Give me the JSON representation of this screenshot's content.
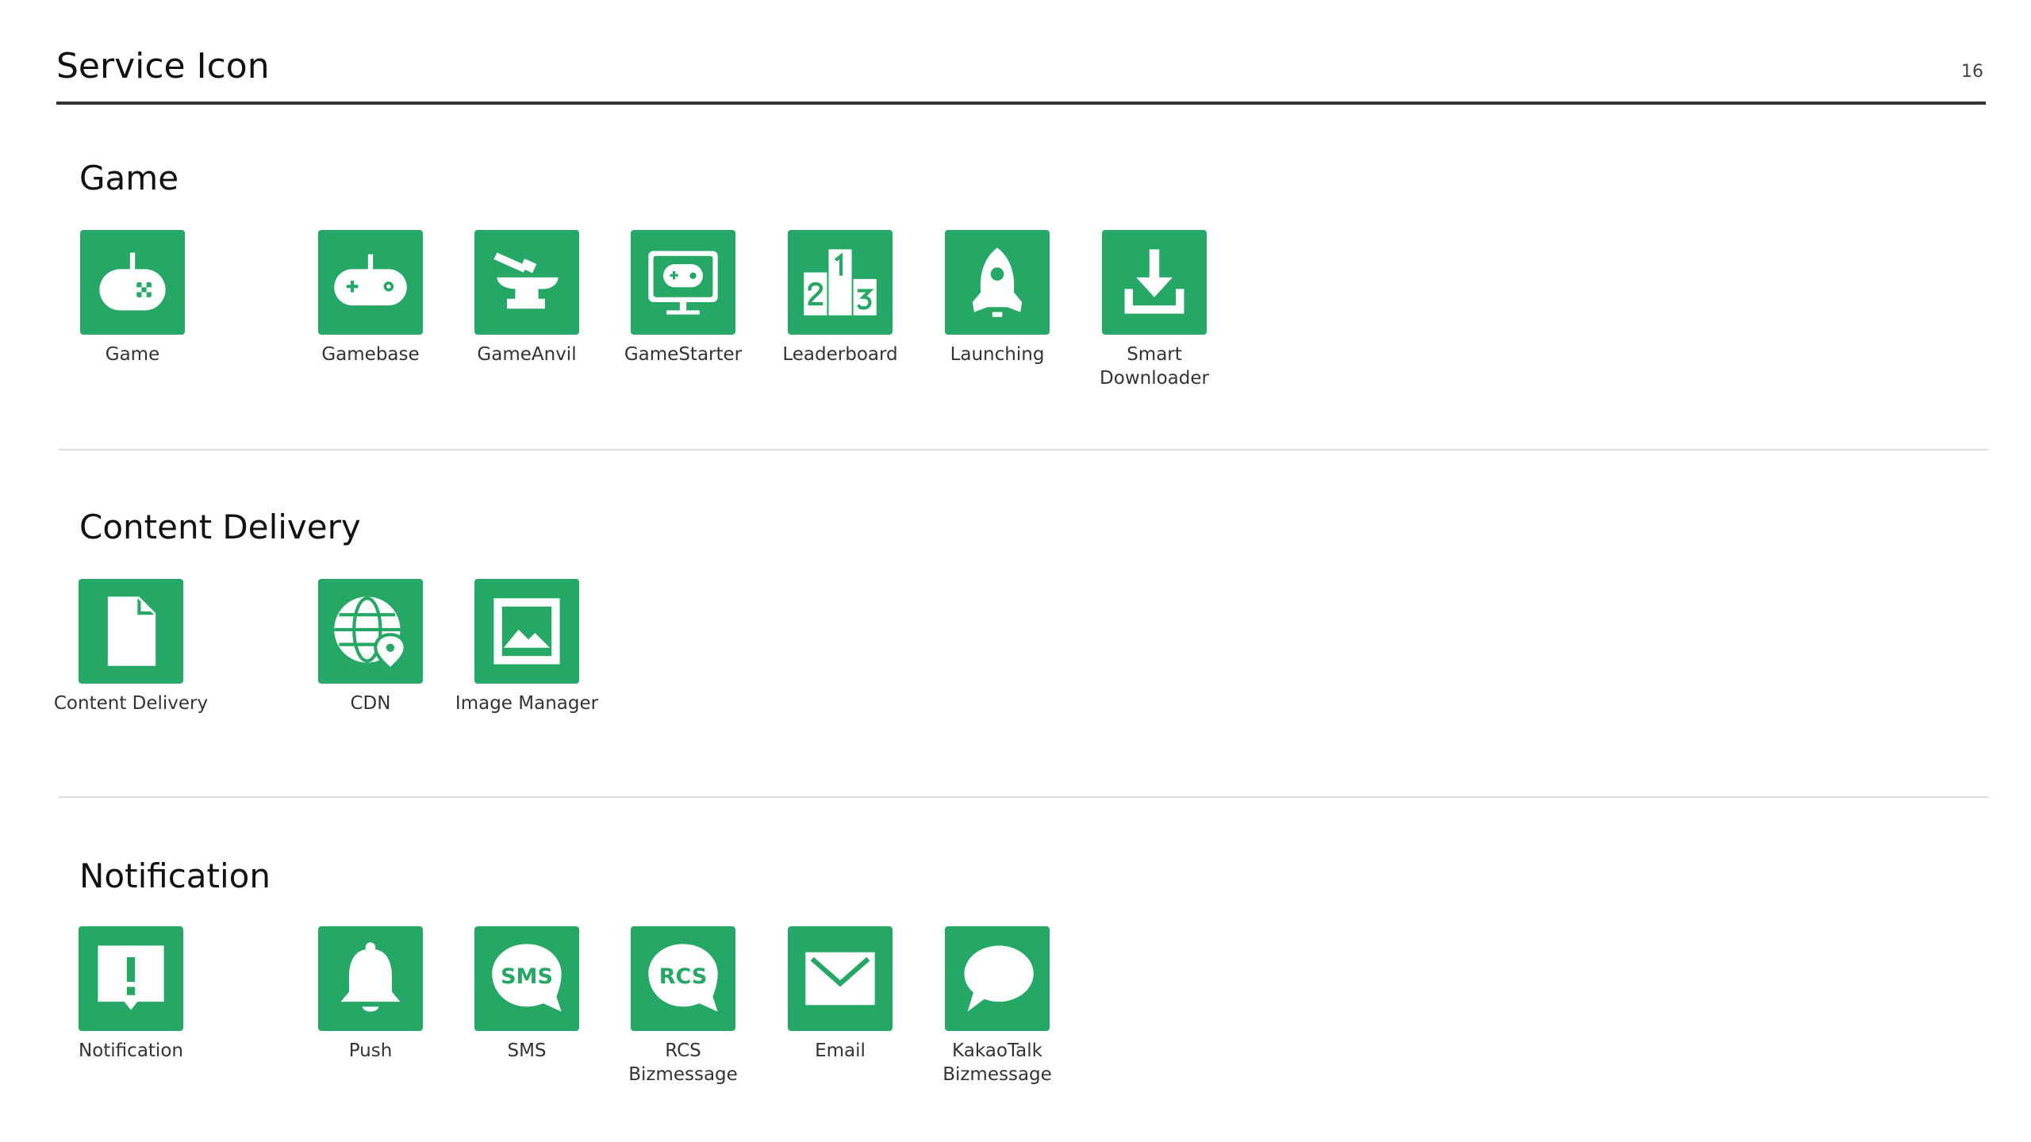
{
  "header": {
    "title": "Service Icon",
    "page_number": "16"
  },
  "sections": {
    "game": {
      "title": "Game",
      "items": [
        {
          "label": "Game",
          "icon": "gamepad-icon"
        },
        {
          "label": "Gamebase",
          "icon": "gamebase-controller-icon"
        },
        {
          "label": "GameAnvil",
          "icon": "anvil-hammer-icon"
        },
        {
          "label": "GameStarter",
          "icon": "game-monitor-icon"
        },
        {
          "label": "Leaderboard",
          "icon": "podium-icon"
        },
        {
          "label": "Launching",
          "icon": "rocket-icon"
        },
        {
          "label": "Smart\nDownloader",
          "icon": "download-icon"
        }
      ]
    },
    "content_delivery": {
      "title": "Content Delivery",
      "items": [
        {
          "label": "Content Delivery",
          "icon": "document-icon"
        },
        {
          "label": "CDN",
          "icon": "globe-pin-icon"
        },
        {
          "label": "Image Manager",
          "icon": "image-icon"
        }
      ]
    },
    "notification": {
      "title": "Notification",
      "items": [
        {
          "label": "Notification",
          "icon": "alert-message-icon"
        },
        {
          "label": "Push",
          "icon": "bell-icon"
        },
        {
          "label": "SMS",
          "icon": "sms-bubble-icon",
          "glyph": "SMS"
        },
        {
          "label": "RCS\nBizmessage",
          "icon": "rcs-bubble-icon",
          "glyph": "RCS"
        },
        {
          "label": "Email",
          "icon": "envelope-icon"
        },
        {
          "label": "KakaoTalk\nBizmessage",
          "icon": "chat-bubble-icon"
        }
      ]
    }
  },
  "colors": {
    "icon_green": "#25a865",
    "rule_dark": "#333333",
    "rule_light": "#dcdcdc"
  }
}
